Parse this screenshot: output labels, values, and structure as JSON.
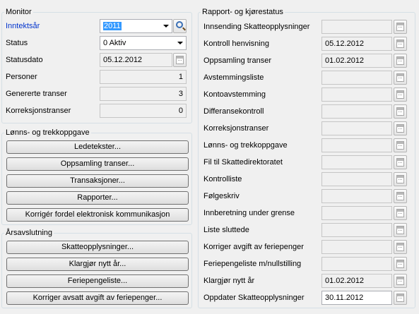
{
  "monitor": {
    "title": "Monitor",
    "inntektsar_label": "Inntektsår",
    "inntektsar_value": "2011",
    "status_label": "Status",
    "status_value": "0 Aktiv",
    "statusdato_label": "Statusdato",
    "statusdato_value": "05.12.2012",
    "personer_label": "Personer",
    "personer_value": "1",
    "genererte_label": "Genererte transer",
    "genererte_value": "3",
    "korreksjon_label": "Korreksjonstranser",
    "korreksjon_value": "0"
  },
  "lonn": {
    "title": "Lønns- og trekkoppgave",
    "buttons": [
      "Ledetekster...",
      "Oppsamling transer...",
      "Transaksjoner...",
      "Rapporter...",
      "Korrigér fordel elektronisk kommunikasjon"
    ]
  },
  "arsavslutning": {
    "title": "Årsavslutning",
    "buttons": [
      "Skatteopplysninger...",
      "Klargjør nytt år...",
      "Feriepengeliste...",
      "Korriger avsatt avgift av feriepenger..."
    ]
  },
  "rapport": {
    "title": "Rapport- og kjørestatus",
    "rows": [
      {
        "label": "Innsending Skatteopplysninger",
        "value": ""
      },
      {
        "label": "Kontroll henvisning",
        "value": "05.12.2012"
      },
      {
        "label": "Oppsamling transer",
        "value": "01.02.2012"
      },
      {
        "label": "Avstemmingsliste",
        "value": ""
      },
      {
        "label": "Kontoavstemming",
        "value": ""
      },
      {
        "label": "Differansekontroll",
        "value": ""
      },
      {
        "label": "Korreksjonstranser",
        "value": ""
      },
      {
        "label": "Lønns- og trekkoppgave",
        "value": ""
      },
      {
        "label": "Fil til Skattedirektoratet",
        "value": ""
      },
      {
        "label": "Kontrolliste",
        "value": ""
      },
      {
        "label": "Følgeskriv",
        "value": ""
      },
      {
        "label": "Innberetning under grense",
        "value": ""
      },
      {
        "label": "Liste sluttede",
        "value": ""
      },
      {
        "label": "Korriger avgift av feriepenger",
        "value": ""
      },
      {
        "label": "Feriepengeliste m/nullstilling",
        "value": ""
      },
      {
        "label": "Klargjør nytt år",
        "value": "01.02.2012"
      },
      {
        "label": "Oppdater Skatteopplysninger",
        "value": "30.11.2012"
      }
    ]
  },
  "icons": {
    "search": "search-icon",
    "calendar": "calendar-icon",
    "dropdown": "chevron-down-icon"
  }
}
